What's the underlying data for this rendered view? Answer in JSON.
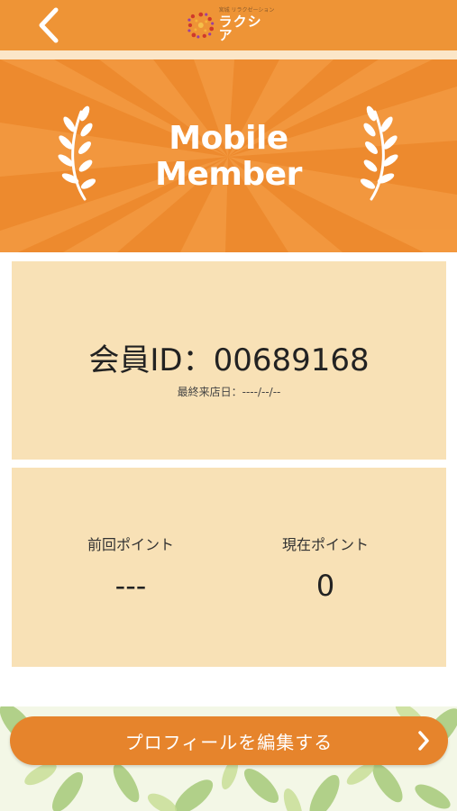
{
  "header": {
    "back_icon": "chevron-left-icon",
    "logo_small_text": "宮城 リラクゼーション",
    "logo_name": "ラクシア"
  },
  "banner": {
    "title_line1": "Mobile",
    "title_line2": "Member"
  },
  "member": {
    "id_text": "会員ID：00689168",
    "last_visit": "最終来店日：----/--/--"
  },
  "points": {
    "previous_label": "前回ポイント",
    "previous_value": "---",
    "current_label": "現在ポイント",
    "current_value": "0"
  },
  "profile_button": {
    "label": "プロフィールを編集する",
    "icon": "chevron-right-icon"
  },
  "colors": {
    "header": "#ee9436",
    "banner": "#ed8a2e",
    "card": "#f8e1b6",
    "button": "#e6842c"
  }
}
